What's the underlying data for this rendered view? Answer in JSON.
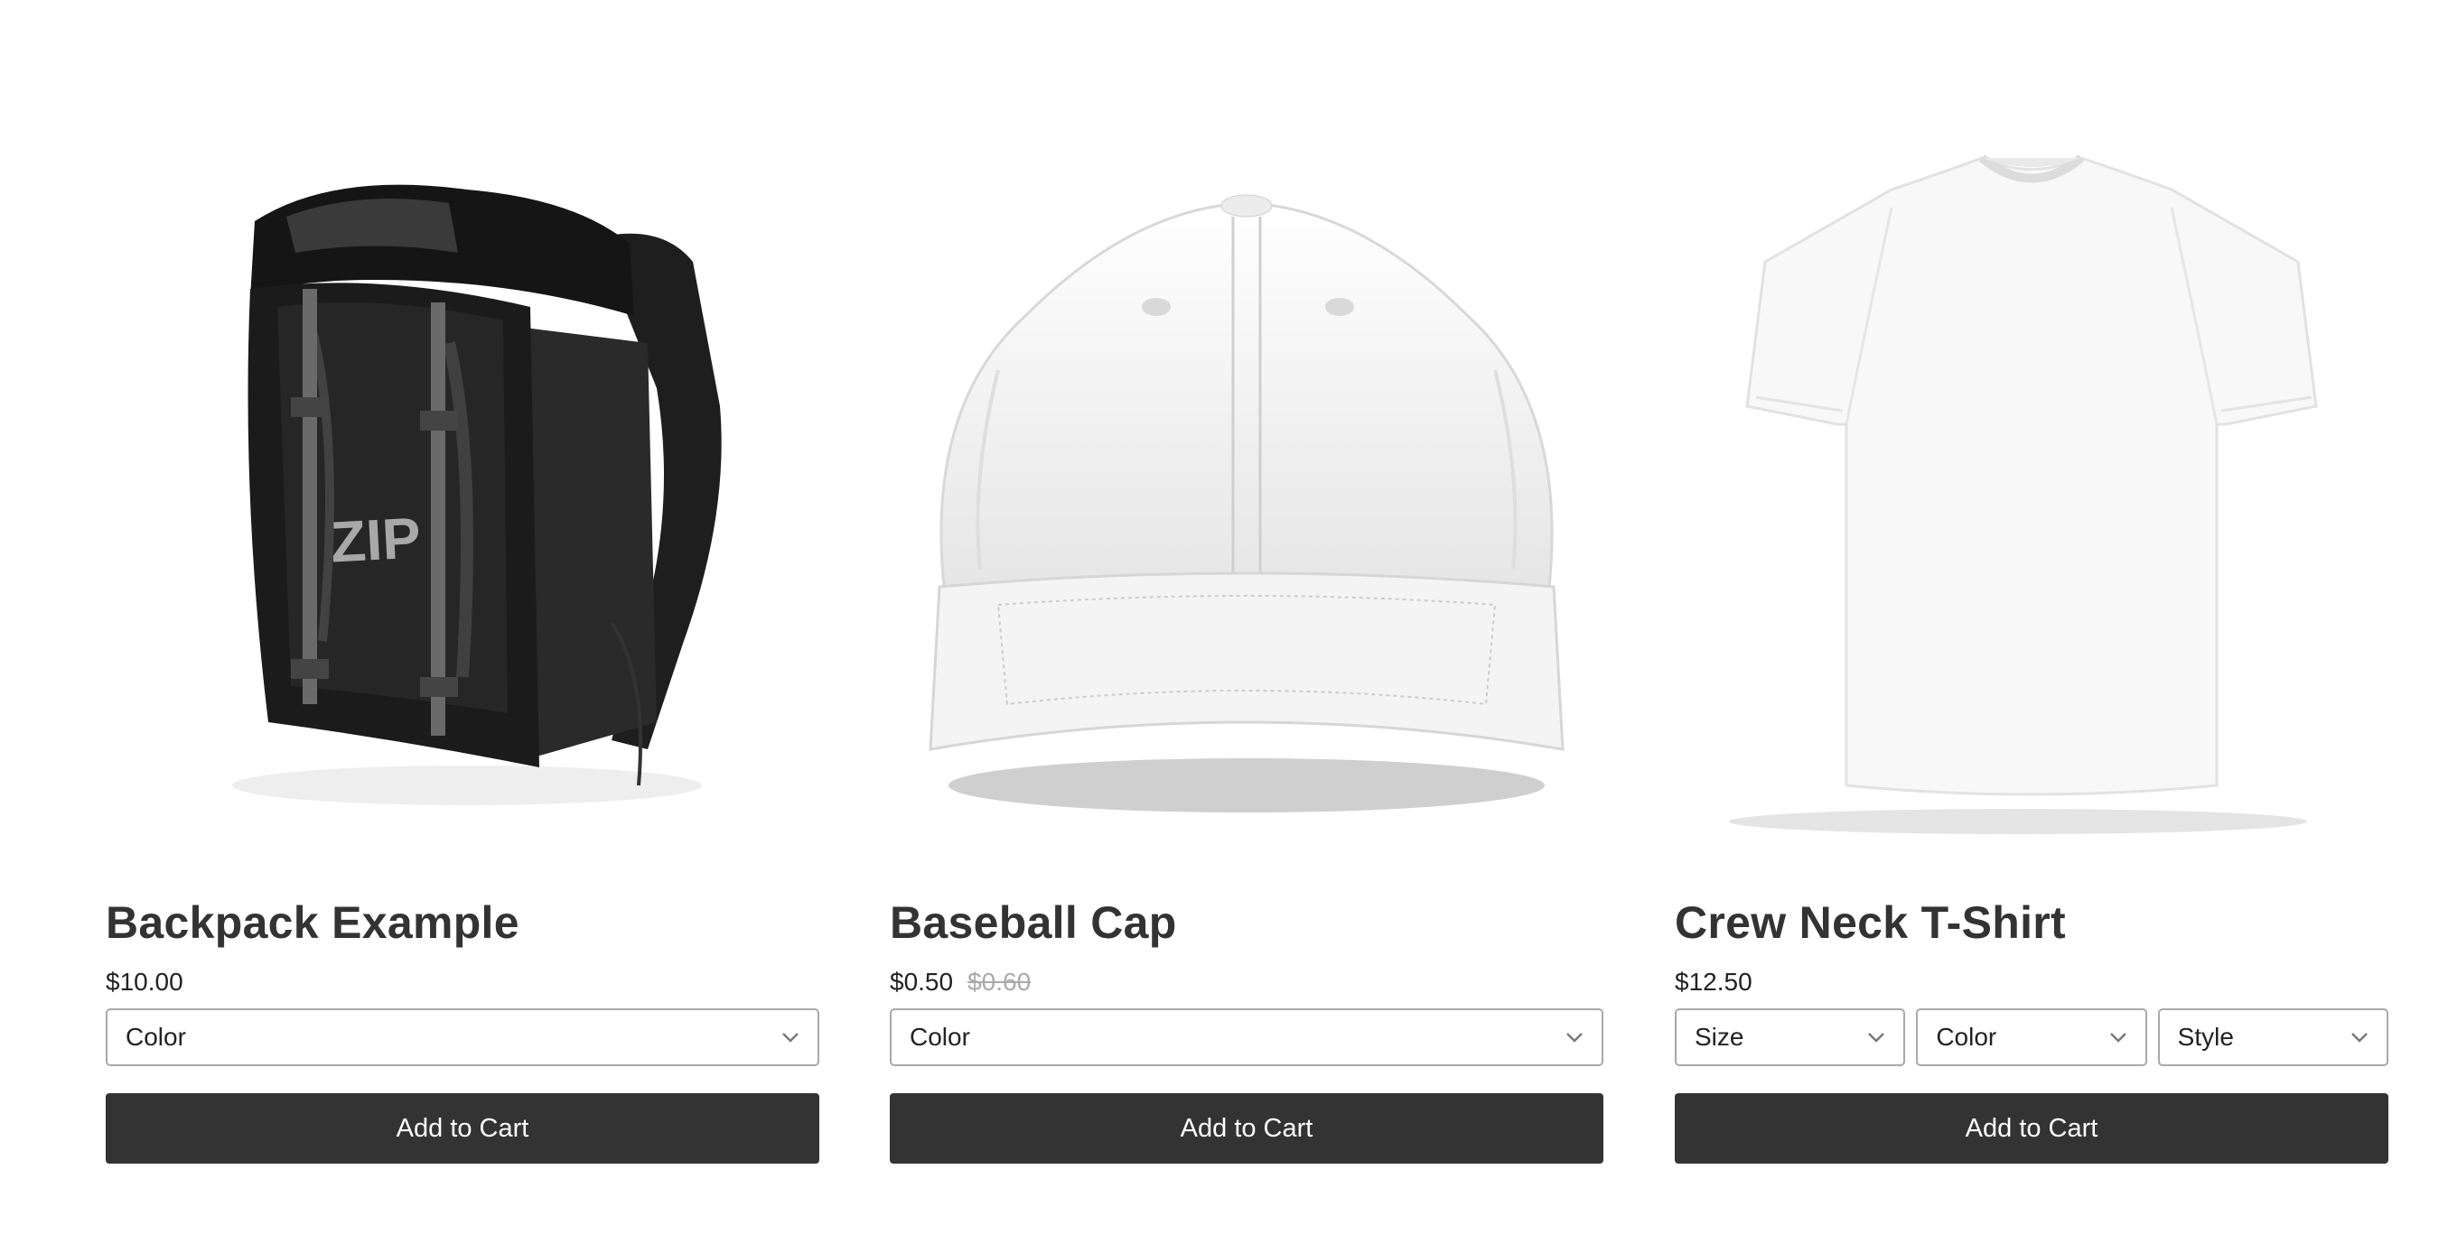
{
  "products": [
    {
      "name": "Backpack Example",
      "price": "$10.00",
      "compare_price": "",
      "options": [
        "Color"
      ],
      "image_logo_text": "ZIP",
      "cta": "Add to Cart"
    },
    {
      "name": "Baseball Cap",
      "price": "$0.50",
      "compare_price": "$0.60",
      "options": [
        "Color"
      ],
      "cta": "Add to Cart"
    },
    {
      "name": "Crew Neck T-Shirt",
      "price": "$12.50",
      "compare_price": "",
      "options": [
        "Size",
        "Color",
        "Style"
      ],
      "cta": "Add to Cart"
    }
  ],
  "colors": {
    "button_bg": "#333333",
    "button_text": "#ffffff",
    "title_text": "#333333",
    "compare_price_text": "#aaaaaa",
    "select_border": "#a9a9a9"
  },
  "icons": {
    "select_arrow": "chevron-down-icon"
  }
}
